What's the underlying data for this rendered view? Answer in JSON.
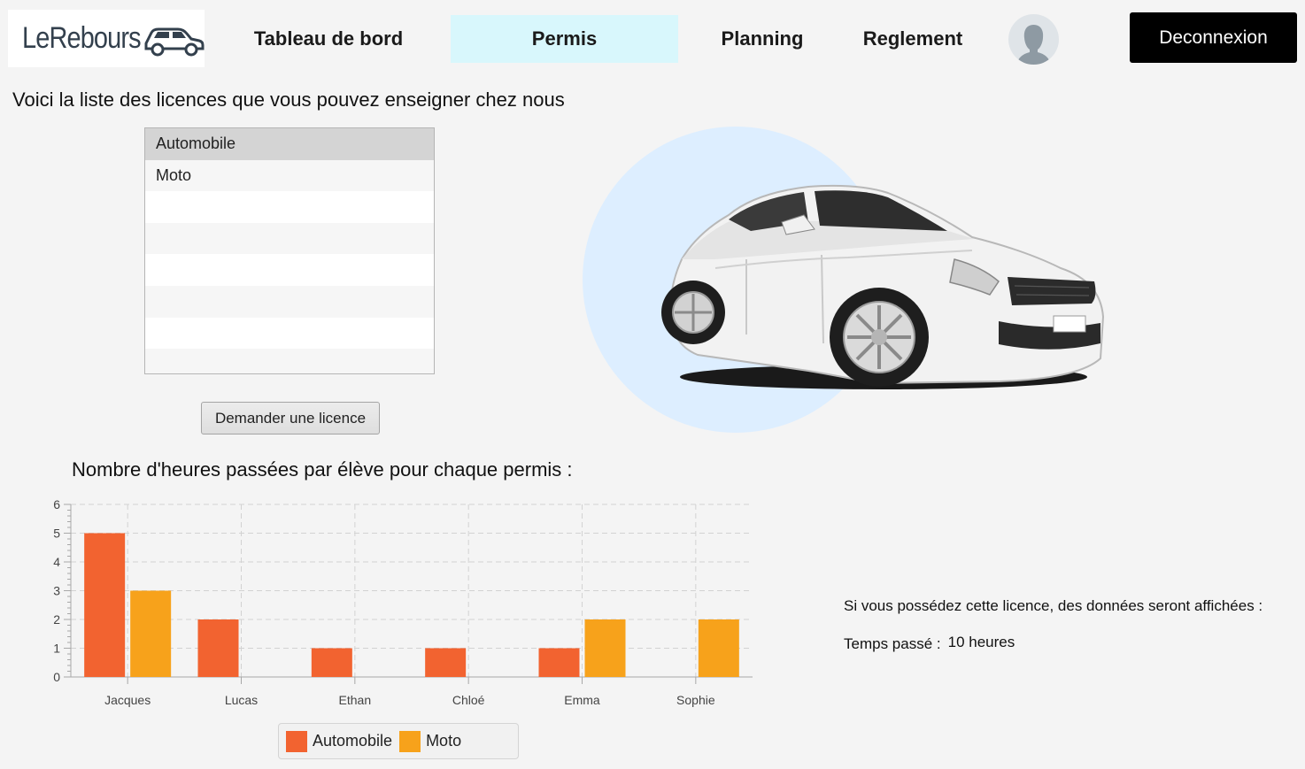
{
  "header": {
    "logo_text": "LeRebours",
    "nav": [
      {
        "label": "Tableau de bord",
        "active": false
      },
      {
        "label": "Permis",
        "active": true
      },
      {
        "label": "Planning",
        "active": false
      },
      {
        "label": "Reglement",
        "active": false
      }
    ],
    "logout_label": "Deconnexion"
  },
  "licences": {
    "intro": "Voici la liste des licences que vous pouvez enseigner chez nous",
    "items": [
      "Automobile",
      "Moto"
    ],
    "selected": "Automobile",
    "request_button": "Demander une licence"
  },
  "chart_section": {
    "title": "Nombre d'heures passées par élève pour chaque permis :"
  },
  "chart_data": {
    "type": "bar",
    "categories": [
      "Jacques",
      "Lucas",
      "Ethan",
      "Chloé",
      "Emma",
      "Sophie"
    ],
    "series": [
      {
        "name": "Automobile",
        "color": "#f26330",
        "values": [
          5,
          2,
          1,
          1,
          1,
          0
        ]
      },
      {
        "name": "Moto",
        "color": "#f7a21b",
        "values": [
          3,
          0,
          0,
          0,
          2,
          2
        ]
      }
    ],
    "ylim": [
      0,
      6
    ],
    "yticks": [
      0,
      1,
      2,
      3,
      4,
      5,
      6
    ],
    "grid": true,
    "legend": "bottom"
  },
  "info": {
    "line1": "Si vous possédez cette licence, des données seront affichées :",
    "time_label": "Temps passé :",
    "time_value": "10 heures"
  },
  "colors": {
    "accent_nav": "#d8f7fc",
    "logout_bg": "#000000",
    "illus_circle": "#ddeeff"
  },
  "icons": {
    "logo": "car-icon",
    "avatar": "user-silhouette-icon"
  }
}
